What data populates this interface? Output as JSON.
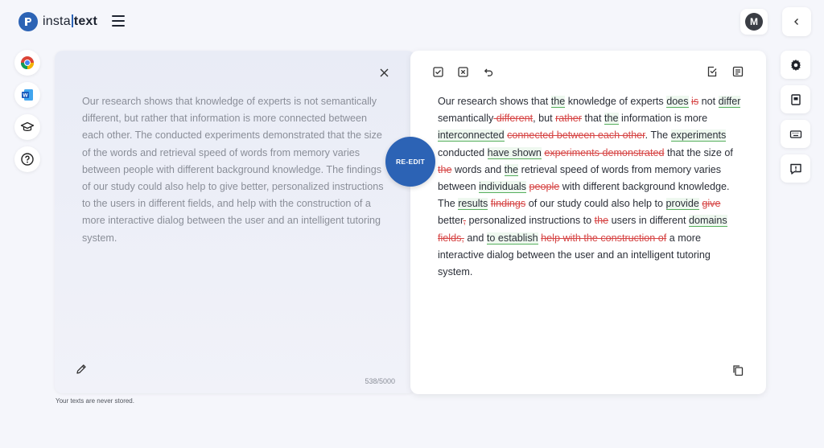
{
  "header": {
    "logo_left": "insta",
    "logo_right": "text",
    "avatar_initial": "M"
  },
  "input": {
    "text": "Our research shows that knowledge of experts is not semantically different, but rather that information is more connected between each other. The conducted experiments demonstrated that the size of the words and retrieval speed of words from memory varies between people with different background knowledge. The findings of our study could also help to give better, personalized instructions to the users in different fields, and help with the construction of a more interactive dialog between the user and an intelligent tutoring system.",
    "counter": "538/5000",
    "note": "Your texts are never stored."
  },
  "reedit_label": "RE-EDIT",
  "output": {
    "segments": [
      {
        "t": "Our research shows that "
      },
      {
        "t": "the",
        "k": "add"
      },
      {
        "t": " knowledge of experts "
      },
      {
        "t": "does",
        "k": "add"
      },
      {
        "t": " "
      },
      {
        "t": "is",
        "k": "del"
      },
      {
        "t": " not "
      },
      {
        "t": "differ",
        "k": "add"
      },
      {
        "t": " semantically"
      },
      {
        "t": " different",
        "k": "del"
      },
      {
        "t": ", but "
      },
      {
        "t": "rather",
        "k": "del"
      },
      {
        "t": " that "
      },
      {
        "t": "the",
        "k": "add"
      },
      {
        "t": " information is more "
      },
      {
        "t": "interconnected",
        "k": "add"
      },
      {
        "t": " "
      },
      {
        "t": "connected between each other",
        "k": "del"
      },
      {
        "t": ". The "
      },
      {
        "t": "experiments",
        "k": "add"
      },
      {
        "t": " conducted "
      },
      {
        "t": "have shown",
        "k": "add"
      },
      {
        "t": " "
      },
      {
        "t": "experiments demonstrated",
        "k": "del"
      },
      {
        "t": " that the size of "
      },
      {
        "t": "the",
        "k": "del"
      },
      {
        "t": " words and "
      },
      {
        "t": "the",
        "k": "add"
      },
      {
        "t": " retrieval speed of words from memory varies between "
      },
      {
        "t": "individuals",
        "k": "add"
      },
      {
        "t": " "
      },
      {
        "t": "people",
        "k": "del"
      },
      {
        "t": " with different background knowledge. The "
      },
      {
        "t": "results",
        "k": "add"
      },
      {
        "t": " "
      },
      {
        "t": "findings",
        "k": "del"
      },
      {
        "t": " of our study could also help to "
      },
      {
        "t": "provide",
        "k": "add"
      },
      {
        "t": " "
      },
      {
        "t": "give",
        "k": "del"
      },
      {
        "t": " better"
      },
      {
        "t": ",",
        "k": "del"
      },
      {
        "t": " personalized instructions to "
      },
      {
        "t": "the",
        "k": "del"
      },
      {
        "t": " users in different "
      },
      {
        "t": "domains",
        "k": "add"
      },
      {
        "t": " "
      },
      {
        "t": "fields,",
        "k": "del"
      },
      {
        "t": " and "
      },
      {
        "t": "to establish",
        "k": "add"
      },
      {
        "t": " "
      },
      {
        "t": "help with the construction of",
        "k": "del"
      },
      {
        "t": " a more interactive dialog between the user and an intelligent tutoring system."
      }
    ]
  },
  "colors": {
    "brand": "#2c63b5",
    "added": "#56b05d",
    "removed": "#d64545"
  },
  "icons": {
    "left_rail": [
      "chrome-icon",
      "word-icon",
      "graduation-cap-icon",
      "help-icon"
    ],
    "right_rail": [
      "gear-icon",
      "book-icon",
      "keyboard-icon",
      "feedback-icon"
    ],
    "toolbar": [
      "accept-all-icon",
      "reject-all-icon",
      "undo-icon",
      "checklist-icon",
      "notes-icon"
    ]
  }
}
